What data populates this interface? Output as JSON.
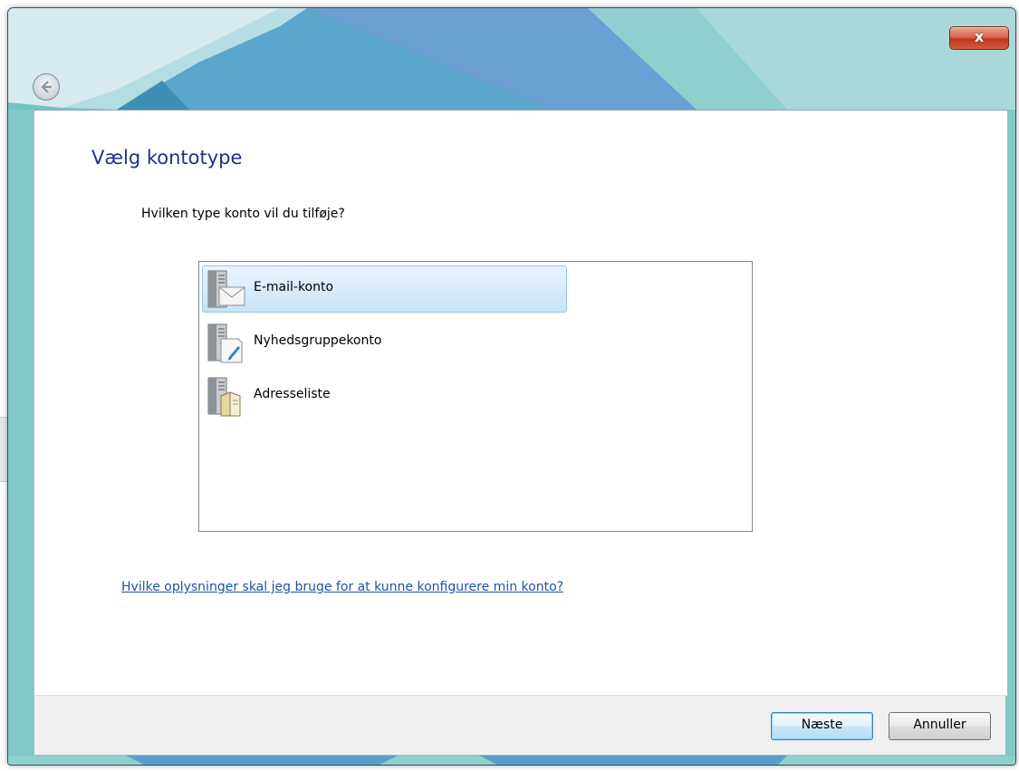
{
  "window": {
    "close_label": "x"
  },
  "page": {
    "title": "Vælg kontotype",
    "question": "Hvilken type konto vil du tilføje?"
  },
  "account_types": [
    {
      "label": "E-mail-konto",
      "icon": "mail-server-icon",
      "selected": true
    },
    {
      "label": "Nyhedsgruppekonto",
      "icon": "newsgroup-server-icon",
      "selected": false
    },
    {
      "label": "Adresseliste",
      "icon": "address-book-server-icon",
      "selected": false
    }
  ],
  "help_link": "Hvilke oplysninger skal jeg bruge for at kunne konfigurere min konto?",
  "buttons": {
    "next": "Næste",
    "cancel": "Annuller"
  },
  "colors": {
    "title": "#1e3287",
    "link": "#1f53a6",
    "selection": "#d9ecfb",
    "close": "#c0391f"
  }
}
